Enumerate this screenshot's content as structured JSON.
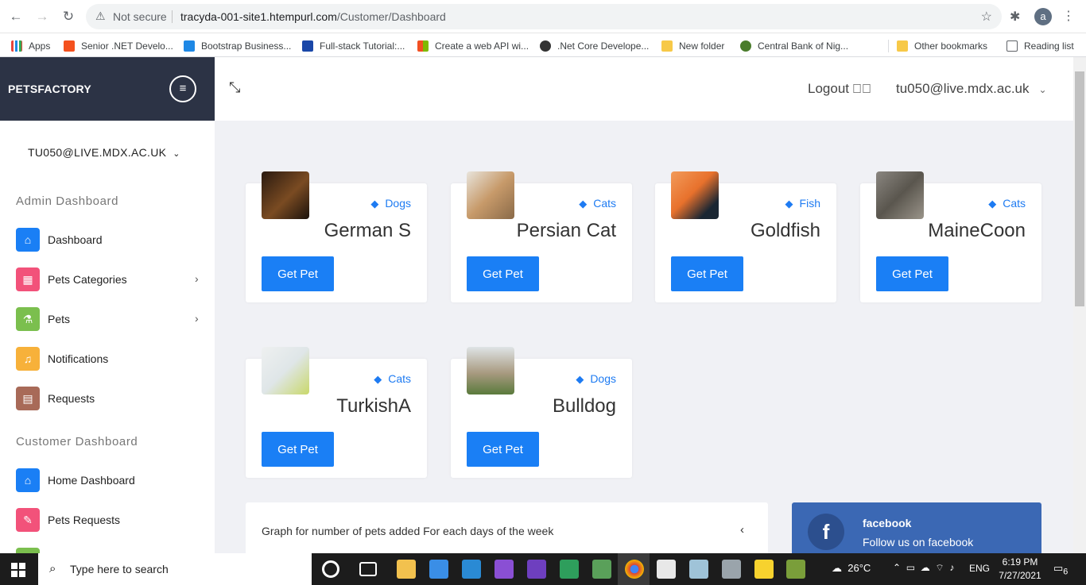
{
  "browser": {
    "not_secure": "Not secure",
    "url_host": "tracyda-001-site1.htempurl.com",
    "url_path": "/Customer/Dashboard",
    "profile_letter": "a",
    "bookmarks": [
      {
        "label": "Apps",
        "color": "#e8453c"
      },
      {
        "label": "Senior .NET Develo...",
        "color": "#f4511e"
      },
      {
        "label": "Bootstrap Business...",
        "color": "#1e88e5"
      },
      {
        "label": "Full-stack Tutorial:...",
        "color": "#1a47a8"
      },
      {
        "label": "Create a web API wi...",
        "color": "#7cbb00"
      },
      {
        "label": ".Net Core Develope...",
        "color": "#333333"
      },
      {
        "label": "New folder",
        "color": "#f7c948"
      },
      {
        "label": "Central Bank of Nig...",
        "color": "#4a7c2c"
      }
    ],
    "other_bookmarks": "Other bookmarks",
    "reading_list": "Reading list"
  },
  "sidebar": {
    "brand": "PETSFACTORY",
    "user": "TU050@LIVE.MDX.AC.UK",
    "admin_section": "Admin Dashboard",
    "admin_items": [
      {
        "label": "Dashboard",
        "color": "#1a7ff5",
        "icon": "home-icon"
      },
      {
        "label": "Pets Categories",
        "color": "#f2527a",
        "icon": "grid-icon"
      },
      {
        "label": "Pets",
        "color": "#7bbf4e",
        "icon": "flask-icon"
      },
      {
        "label": "Notifications",
        "color": "#f7b13a",
        "icon": "bell-icon"
      },
      {
        "label": "Requests",
        "color": "#a86a58",
        "icon": "document-icon"
      }
    ],
    "customer_section": "Customer Dashboard",
    "customer_items": [
      {
        "label": "Home Dashboard",
        "color": "#1a7ff5",
        "icon": "home-icon"
      },
      {
        "label": "Pets Requests",
        "color": "#f2527a",
        "icon": "dog-icon"
      }
    ]
  },
  "topbar": {
    "logout": "Logout",
    "user_email": "tu050@live.mdx.ac.uk"
  },
  "pets": [
    {
      "name": "German S",
      "category": "Dogs",
      "button": "Get Pet",
      "img_color": "#5a3b20"
    },
    {
      "name": "Persian Cat",
      "category": "Cats",
      "button": "Get Pet",
      "img_color": "#c79a6a"
    },
    {
      "name": "Goldfish",
      "category": "Fish",
      "button": "Get Pet",
      "img_color": "#e8712c"
    },
    {
      "name": "MaineCoon",
      "category": "Cats",
      "button": "Get Pet",
      "img_color": "#6f6b63"
    },
    {
      "name": "TurkishA",
      "category": "Cats",
      "button": "Get Pet",
      "img_color": "#d8e3a0"
    },
    {
      "name": "Bulldog",
      "category": "Dogs",
      "button": "Get Pet",
      "img_color": "#a89a80"
    }
  ],
  "graph_panel": {
    "title": "Graph for number of pets added For each days of the week"
  },
  "facebook": {
    "title": "facebook",
    "subtitle": "Follow us on facebook"
  },
  "taskbar": {
    "search_placeholder": "Type here to search",
    "weather": "26°C",
    "lang": "ENG",
    "time": "6:19 PM",
    "date": "7/27/2021",
    "notifications": "6"
  }
}
